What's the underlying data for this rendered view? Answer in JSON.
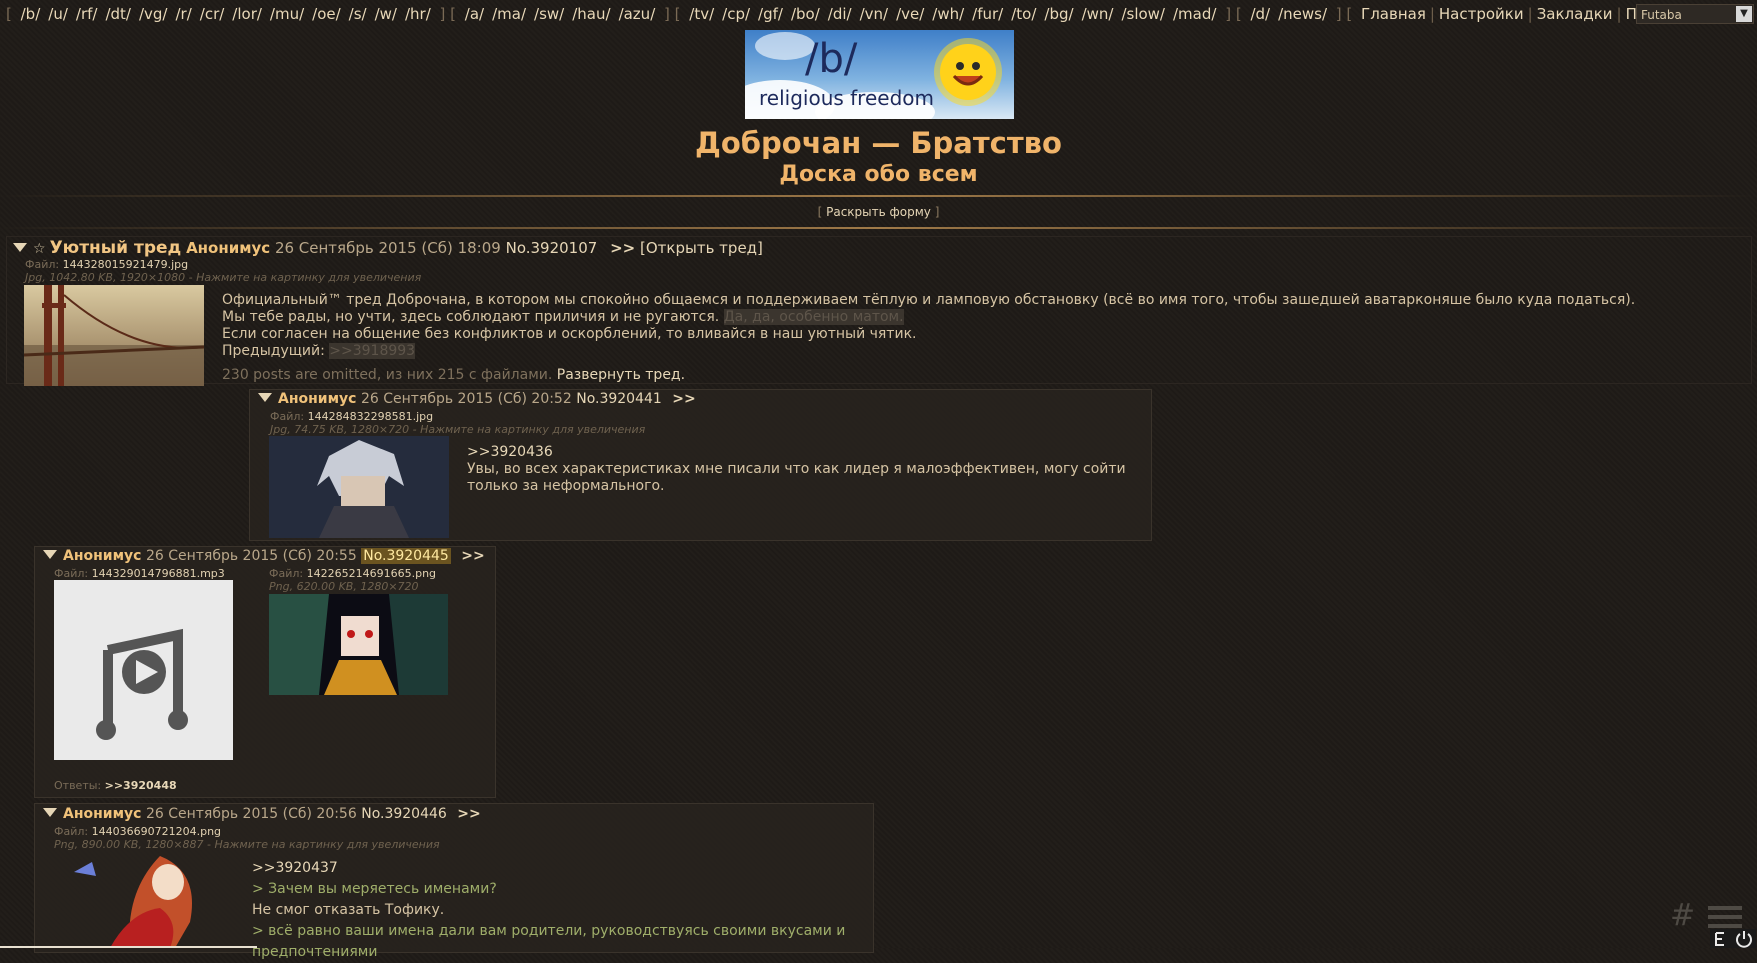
{
  "nav": {
    "group1": [
      "/b/",
      "/u/",
      "/rf/",
      "/dt/",
      "/vg/",
      "/r/",
      "/cr/",
      "/lor/",
      "/mu/",
      "/oe/",
      "/s/",
      "/w/",
      "/hr/"
    ],
    "group2": [
      "/a/",
      "/ma/",
      "/sw/",
      "/hau/",
      "/azu/"
    ],
    "group3": [
      "/tv/",
      "/cp/",
      "/gf/",
      "/bo/",
      "/di/",
      "/vn/",
      "/ve/",
      "/wh/",
      "/fur/",
      "/to/",
      "/bg/",
      "/wn/",
      "/slow/",
      "/mad/"
    ],
    "group4": [
      "/d/",
      "/news/"
    ],
    "group5": [
      "Главная",
      "Настройки",
      "Закладки",
      "Плеер"
    ]
  },
  "style_select": {
    "value": "Futaba"
  },
  "banner": {
    "board": "/b/",
    "caption": "religious freedom"
  },
  "header": {
    "title": "Доброчан — Братство",
    "subtitle": "Доска обо всем",
    "toggle_form": "Раскрыть форму"
  },
  "op": {
    "subject": "Уютный тред",
    "name": "Анонимус",
    "date": "26 Сентябрь 2015 (Сб) 18:09",
    "number": "No.3920107",
    "arrow": ">>",
    "open_thread": "[Открыть тред]",
    "file_label": "Файл:",
    "file_name": "144328015921479.jpg",
    "file_meta": "Jpg, 1042.80 KB, 1920×1080 - Нажмите на картинку для увеличения",
    "line1": "Официальный™ тред Доброчана, в котором мы спокойно общаемся и поддерживаем тёплую и ламповую обстановку (всё во имя того, чтобы зашедшей аватарконяше было куда податься).",
    "line2": "Мы тебе рады, но учти, здесь соблюдают приличия и не ругаются.",
    "line2_spoiler": "Да, да, особенно матом.",
    "line3": "Если согласен на общение без конфликтов и оскорблений, то вливайся в наш уютный чятик.",
    "line4_label": "Предыдущий:",
    "line4_spoiler": ">>3918993",
    "omitted": "230 posts are omitted, из них 215 с файлами.",
    "expand": "Развернуть тред."
  },
  "reply1": {
    "name": "Анонимус",
    "date": "26 Сентябрь 2015 (Сб) 20:52",
    "number": "No.3920441",
    "arrow": ">>",
    "file_label": "Файл:",
    "file_name": "144284832298581.jpg",
    "file_meta": "Jpg, 74.75 KB, 1280×720 - Нажмите на картинку для увеличения",
    "ref": ">>3920436",
    "text": "Увы, во всех характеристиках мне писали что как лидер я малоэффективен, могу сойти только за неформального."
  },
  "reply2": {
    "name": "Анонимус",
    "date": "26 Сентябрь 2015 (Сб) 20:55",
    "number": "No.3920445",
    "arrow": ">>",
    "file1_label": "Файл:",
    "file1_name": "144329014796881.mp3",
    "file2_label": "Файл:",
    "file2_name": "142265214691665.png",
    "file2_meta": "Png, 620.00 KB, 1280×720",
    "answers_label": "Ответы:",
    "answers_ref": ">>3920448"
  },
  "reply3": {
    "name": "Анонимус",
    "date": "26 Сентябрь 2015 (Сб) 20:56",
    "number": "No.3920446",
    "arrow": ">>",
    "file_label": "Файл:",
    "file_name": "144036690721204.png",
    "file_meta": "Png, 890.00 KB, 1280×887 - Нажмите на картинку для увеличения",
    "ref": ">>3920437",
    "quote1": "> Зачем вы меряетесь именами?",
    "line2": "Не смог отказать Тофику.",
    "quote2": "> всё равно ваши имена дали вам родители, руководствуясь своими вкусами и",
    "quote2_cont": "предпочтениями"
  },
  "corner": {
    "hash": "#"
  },
  "colors": {
    "background": "#1f1b17",
    "accent": "#f0b46a",
    "name": "#f0c27a",
    "quote": "#9fae6a"
  }
}
